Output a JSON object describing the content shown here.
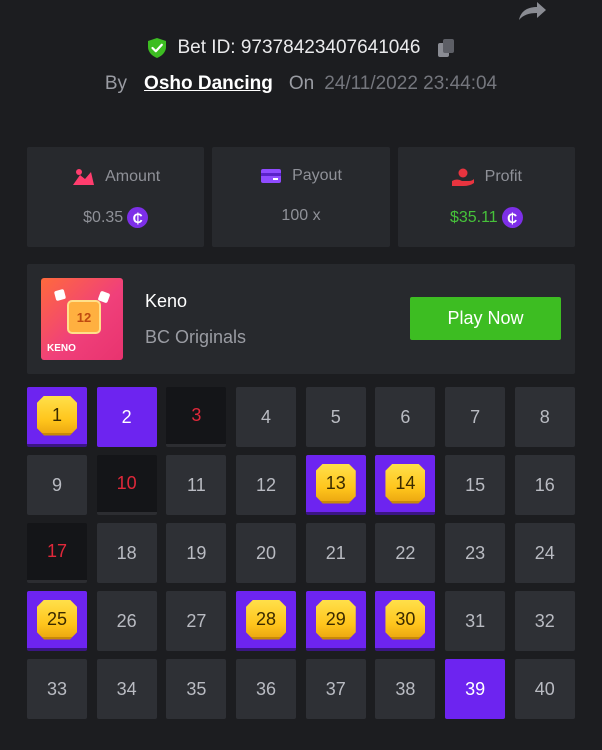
{
  "header": {
    "bet_id_label": "Bet ID: 97378423407641046",
    "by_label": "By",
    "username": "Osho Dancing",
    "on_label": "On",
    "datetime": "24/11/2022 23:44:04"
  },
  "stats": {
    "amount_label": "Amount",
    "amount_value": "$0.35",
    "payout_label": "Payout",
    "payout_value": "100 x",
    "profit_label": "Profit",
    "profit_value": "$35.11",
    "coin_symbol": "₵"
  },
  "game": {
    "name": "Keno",
    "provider": "BC Originals",
    "play_label": "Play Now",
    "thumb_number": "12",
    "thumb_label": "KENO"
  },
  "grid": {
    "cells": [
      {
        "n": "1",
        "state": "hit"
      },
      {
        "n": "2",
        "state": "picked"
      },
      {
        "n": "3",
        "state": "miss"
      },
      {
        "n": "4",
        "state": "normal"
      },
      {
        "n": "5",
        "state": "normal"
      },
      {
        "n": "6",
        "state": "normal"
      },
      {
        "n": "7",
        "state": "normal"
      },
      {
        "n": "8",
        "state": "normal"
      },
      {
        "n": "9",
        "state": "normal"
      },
      {
        "n": "10",
        "state": "miss"
      },
      {
        "n": "11",
        "state": "normal"
      },
      {
        "n": "12",
        "state": "normal"
      },
      {
        "n": "13",
        "state": "hit"
      },
      {
        "n": "14",
        "state": "hit"
      },
      {
        "n": "15",
        "state": "normal"
      },
      {
        "n": "16",
        "state": "normal"
      },
      {
        "n": "17",
        "state": "miss"
      },
      {
        "n": "18",
        "state": "normal"
      },
      {
        "n": "19",
        "state": "normal"
      },
      {
        "n": "20",
        "state": "normal"
      },
      {
        "n": "21",
        "state": "normal"
      },
      {
        "n": "22",
        "state": "normal"
      },
      {
        "n": "23",
        "state": "normal"
      },
      {
        "n": "24",
        "state": "normal"
      },
      {
        "n": "25",
        "state": "hit"
      },
      {
        "n": "26",
        "state": "normal"
      },
      {
        "n": "27",
        "state": "normal"
      },
      {
        "n": "28",
        "state": "hit"
      },
      {
        "n": "29",
        "state": "hit"
      },
      {
        "n": "30",
        "state": "hit"
      },
      {
        "n": "31",
        "state": "normal"
      },
      {
        "n": "32",
        "state": "normal"
      },
      {
        "n": "33",
        "state": "normal"
      },
      {
        "n": "34",
        "state": "normal"
      },
      {
        "n": "35",
        "state": "normal"
      },
      {
        "n": "36",
        "state": "normal"
      },
      {
        "n": "37",
        "state": "normal"
      },
      {
        "n": "38",
        "state": "normal"
      },
      {
        "n": "39",
        "state": "picked"
      },
      {
        "n": "40",
        "state": "normal"
      }
    ]
  },
  "colors": {
    "accent_purple": "#6d24f0",
    "play_green": "#3dbd22",
    "profit_green": "#46c23a",
    "miss_red": "#e0283a"
  },
  "icons": [
    "share-icon",
    "shield-check-icon",
    "copy-icon",
    "amount-icon",
    "payout-card-icon",
    "profit-hand-icon",
    "coin-icon"
  ]
}
